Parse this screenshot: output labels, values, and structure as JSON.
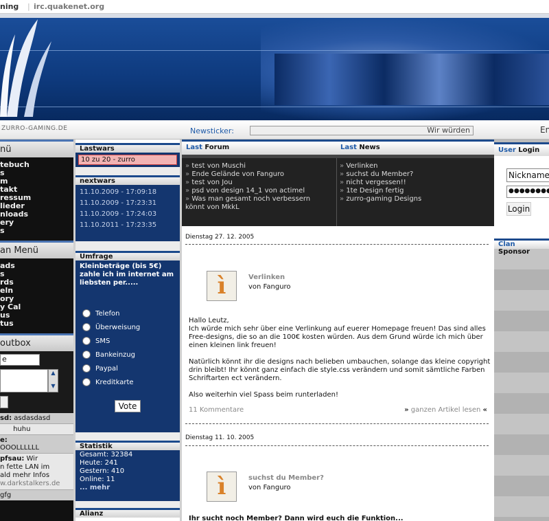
{
  "topbar": {
    "left_text": "ning",
    "irc": "irc.quakenet.org"
  },
  "subbar": {
    "logo_text": "ZURRO-GAMING.DE",
    "newsticker_label": "Newsticker:",
    "ticker_text": "Wir würden",
    "right_edge": "En"
  },
  "left": {
    "menu1_title": "nü",
    "menu1_items": [
      "tebuch",
      "s",
      "m",
      "takt",
      "ressum",
      "lieder",
      "nloads",
      "ery",
      "s"
    ],
    "menu2_title": "an Menü",
    "menu2_items": [
      "ads",
      "s",
      "rds",
      "eln",
      "ory",
      "y Cal",
      "us",
      "tus"
    ],
    "shoutbox_title": "outbox",
    "shout_input": "e",
    "shouts": [
      {
        "name": "sd:",
        "text": "asdasdasd"
      },
      {
        "name": "",
        "text": "huhu"
      },
      {
        "name": "e:",
        "text": "OOOLLLLLL"
      },
      {
        "name": "pfsau:",
        "text": "Wir"
      },
      {
        "name": "",
        "text": "n fette LAN im"
      },
      {
        "name": "",
        "text": "ald mehr Infos"
      },
      {
        "name": "",
        "text": "w.darkstalkers.de"
      },
      {
        "name": "",
        "text": "gfg"
      }
    ]
  },
  "mid": {
    "lastwars_title": "Lastwars",
    "lastwars_item": "10 zu 20 - zurro",
    "nextwars_title": "nextwars",
    "nextwars": [
      "11.10.2009 - 17:09:18",
      "11.10.2009 - 17:23:31",
      "11.10.2009 - 17:24:03",
      "11.10.2011 - 17:23:35"
    ],
    "poll_title": "Umfrage",
    "poll_question": "Kleinbeträge (bis 5€) zahle ich im internet am liebsten per.....",
    "poll_options": [
      "Telefon",
      "Überweisung",
      "SMS",
      "Bankeinzug",
      "Paypal",
      "Kreditkarte"
    ],
    "vote_label": "Vote",
    "stats_title": "Statistik",
    "stats": [
      "Gesamt: 32384",
      "Heute: 241",
      "Gestern: 410",
      "Online: 11"
    ],
    "stats_more": "... mehr",
    "allianz_title": "Alianz"
  },
  "center": {
    "tab_forum_a": "Last",
    "tab_forum_b": "Forum",
    "tab_news_a": "Last",
    "tab_news_b": "News",
    "forum_items": [
      "test von Muschi",
      "Ende Gelände von Fanguro",
      "test von Jou",
      "psd von design 14_1 von actimel",
      "Was man gesamt noch verbessern"
    ],
    "forum_item_cont": "könnt von MkkL",
    "news_items": [
      "Verlinken",
      "suchst du Member?",
      "nicht vergessen!!",
      "1te Design fertig",
      "zurro-gaming Designs"
    ],
    "articles": [
      {
        "date": "Dienstag 27. 12. 2005",
        "title": "Verlinken",
        "author": "von Fanguro",
        "p1": "Hallo Leutz,",
        "p2": "Ich würde mich sehr über eine Verlinkung auf euerer Homepage freuen! Das sind alles Free-designs, die so an die 100€ kosten würden. Aus dem Grund würde ich mich über einen kleinen link freuen!",
        "p3": "Natürlich könnt ihr die designs nach belieben umbauchen, solange das kleine copyright drin bleibt! Ihr könnt ganz einfach die style.css verändern und somit sämtliche Farben Schriftarten ect verändern.",
        "p4": "Also weiterhin viel Spass beim runterladen!",
        "comments": "11 Kommentare",
        "readmore": "ganzen Artikel lesen"
      },
      {
        "date": "Dienstag 11. 10. 2005",
        "title": "suchst du Member?",
        "author": "von Fanguro",
        "p1": "Ihr sucht noch Member? Dann wird euch die Funktion..."
      }
    ]
  },
  "right": {
    "login_a": "User",
    "login_b": "Login",
    "nickname": "Nickname",
    "password": "●●●●●●●●",
    "login_btn": "Login",
    "sponsor_a": "Clan",
    "sponsor_b": "Sponsor"
  }
}
